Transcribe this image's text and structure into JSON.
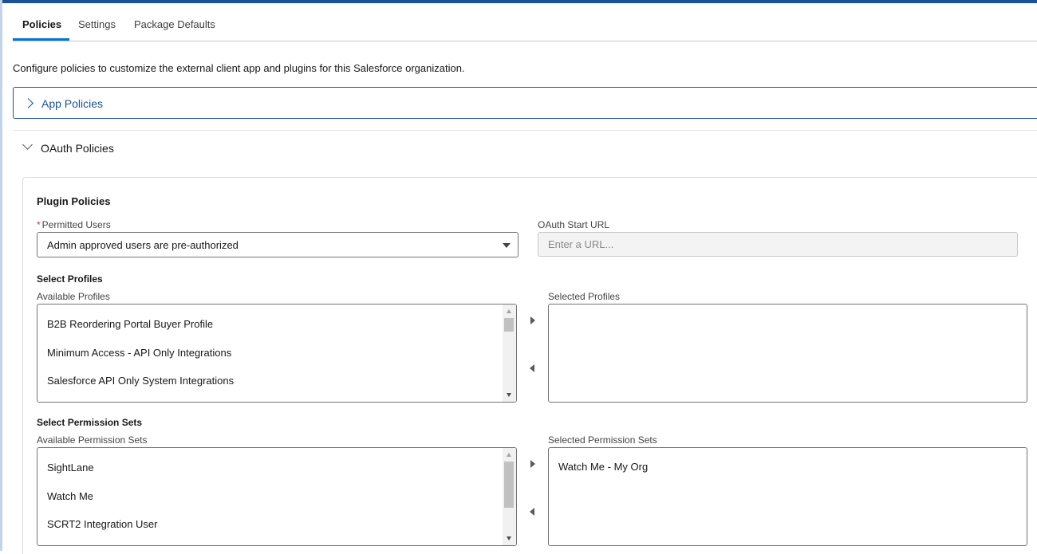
{
  "tabs": [
    {
      "label": "Policies",
      "active": true
    },
    {
      "label": "Settings",
      "active": false
    },
    {
      "label": "Package Defaults",
      "active": false
    }
  ],
  "intro": "Configure policies to customize the external client app and plugins for this Salesforce organization.",
  "sections": {
    "app_policies": {
      "label": "App Policies",
      "icon": "chevron-right-icon"
    },
    "oauth_policies": {
      "label": "OAuth Policies",
      "icon": "chevron-down-icon"
    }
  },
  "plugin": {
    "title": "Plugin Policies",
    "permitted_users": {
      "required_mark": "*",
      "label": "Permitted Users",
      "value": "Admin approved users are pre-authorized"
    },
    "oauth_start_url": {
      "label": "OAuth Start URL",
      "placeholder": "Enter a URL..."
    },
    "profiles": {
      "section_title": "Select Profiles",
      "available_label": "Available Profiles",
      "selected_label": "Selected Profiles",
      "available": [
        "B2B Reordering Portal Buyer Profile",
        "Minimum Access - API Only Integrations",
        "Salesforce API Only System Integrations"
      ],
      "selected": []
    },
    "permission_sets": {
      "section_title": "Select Permission Sets",
      "available_label": "Available Permission Sets",
      "selected_label": "Selected Permission Sets",
      "available": [
        "SightLane",
        "Watch Me",
        "SCRT2 Integration User"
      ],
      "selected": [
        "Watch Me - My Org"
      ]
    }
  },
  "colors": {
    "accent": "#0176d3",
    "link": "#1b5297",
    "required": "#c23934"
  }
}
